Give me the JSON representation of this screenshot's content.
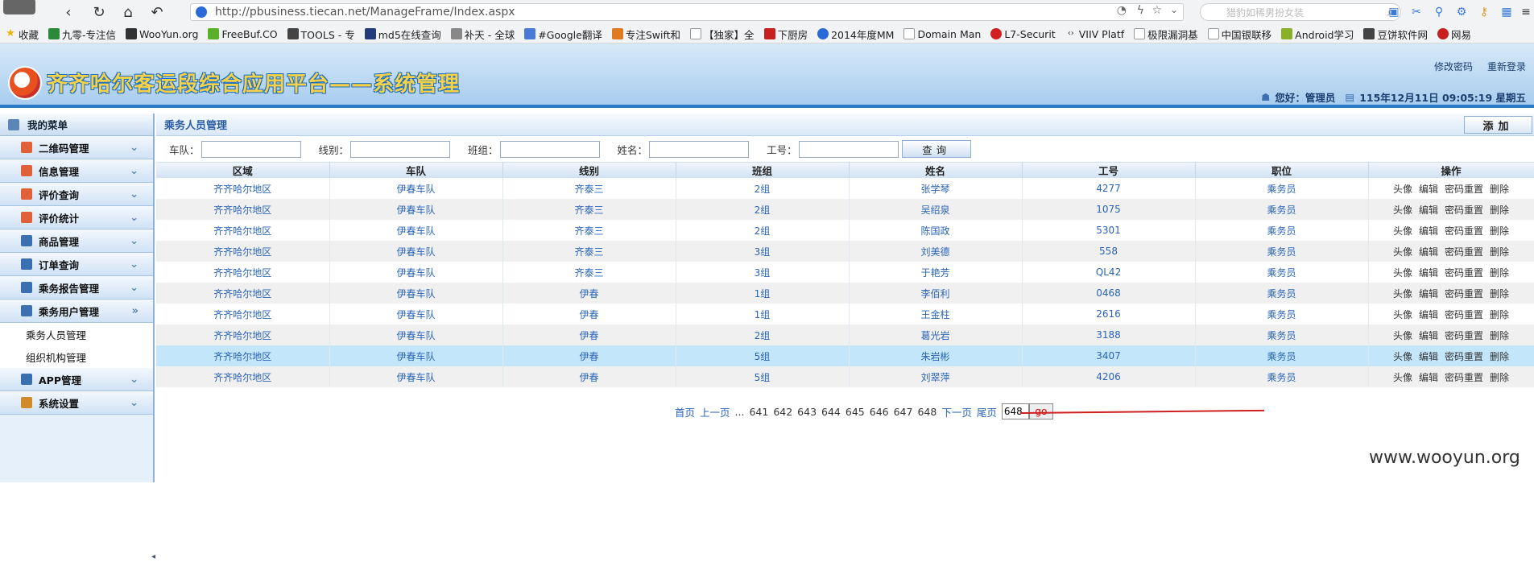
{
  "browser": {
    "url": "http://pbusiness.tiecan.net/ManageFrame/Index.aspx",
    "search_placeholder": "猎豹如稀男扮女装",
    "bookmarks": [
      "收藏",
      "九零-专注信",
      "WooYun.org",
      "FreeBuf.CO",
      "TOOLS - 专",
      "md5在线查询",
      "补天 - 全球",
      "#Google翻译",
      "专注Swift和",
      "【独家】全",
      "下厨房",
      "2014年度MM",
      "Domain Man",
      "L7-Securit",
      "VIIV Platf",
      "极限漏洞基",
      "中国银联移",
      "Android学习",
      "豆饼软件网",
      "网易"
    ]
  },
  "header": {
    "title": "齐齐哈尔客运段综合应用平台——系统管理",
    "change_password": "修改密码",
    "relogin": "重新登录",
    "greeting": "您好：管理员",
    "datetime": "115年12月11日 09:05:19 星期五"
  },
  "sidebar": {
    "title": "我的菜单",
    "menus": [
      "二维码管理",
      "信息管理",
      "评价查询",
      "评价统计",
      "商品管理",
      "订单查询",
      "乘务报告管理",
      "乘务用户管理"
    ],
    "submenus": [
      "乘务人员管理",
      "组织机构管理"
    ],
    "menus_after": [
      "APP管理",
      "系统设置"
    ]
  },
  "main": {
    "panel_title": "乘务人员管理",
    "add_label": "添加",
    "filters": {
      "team": "车队：",
      "line": "线别：",
      "group": "班组：",
      "name": "姓名：",
      "job_no": "工号："
    },
    "query_label": "查询",
    "columns": [
      "区域",
      "车队",
      "线别",
      "班组",
      "姓名",
      "工号",
      "职位",
      "操作"
    ],
    "ops": [
      "头像",
      "编辑",
      "密码重置",
      "删除"
    ],
    "rows": [
      [
        "齐齐哈尔地区",
        "伊春车队",
        "齐泰三",
        "2组",
        "张学琴",
        "4277",
        "乘务员"
      ],
      [
        "齐齐哈尔地区",
        "伊春车队",
        "齐泰三",
        "2组",
        "吴绍泉",
        "1075",
        "乘务员"
      ],
      [
        "齐齐哈尔地区",
        "伊春车队",
        "齐泰三",
        "2组",
        "陈国政",
        "5301",
        "乘务员"
      ],
      [
        "齐齐哈尔地区",
        "伊春车队",
        "齐泰三",
        "3组",
        "刘美德",
        "558",
        "乘务员"
      ],
      [
        "齐齐哈尔地区",
        "伊春车队",
        "齐泰三",
        "3组",
        "于艳芳",
        "QL42",
        "乘务员"
      ],
      [
        "齐齐哈尔地区",
        "伊春车队",
        "伊春",
        "1组",
        "李佰利",
        "0468",
        "乘务员"
      ],
      [
        "齐齐哈尔地区",
        "伊春车队",
        "伊春",
        "1组",
        "王金柱",
        "2616",
        "乘务员"
      ],
      [
        "齐齐哈尔地区",
        "伊春车队",
        "伊春",
        "2组",
        "葛光岩",
        "3188",
        "乘务员"
      ],
      [
        "齐齐哈尔地区",
        "伊春车队",
        "伊春",
        "5组",
        "朱岩彬",
        "3407",
        "乘务员"
      ],
      [
        "齐齐哈尔地区",
        "伊春车队",
        "伊春",
        "5组",
        "刘翠萍",
        "4206",
        "乘务员"
      ]
    ],
    "pager": {
      "first": "首页",
      "prev": "上一页",
      "ellipsis": "...",
      "pages": [
        "641",
        "642",
        "643",
        "644",
        "645",
        "646",
        "647",
        "648"
      ],
      "next": "下一页",
      "last": "尾页",
      "input_value": "648",
      "go": "go"
    }
  },
  "watermark": "www.wooyun.org"
}
